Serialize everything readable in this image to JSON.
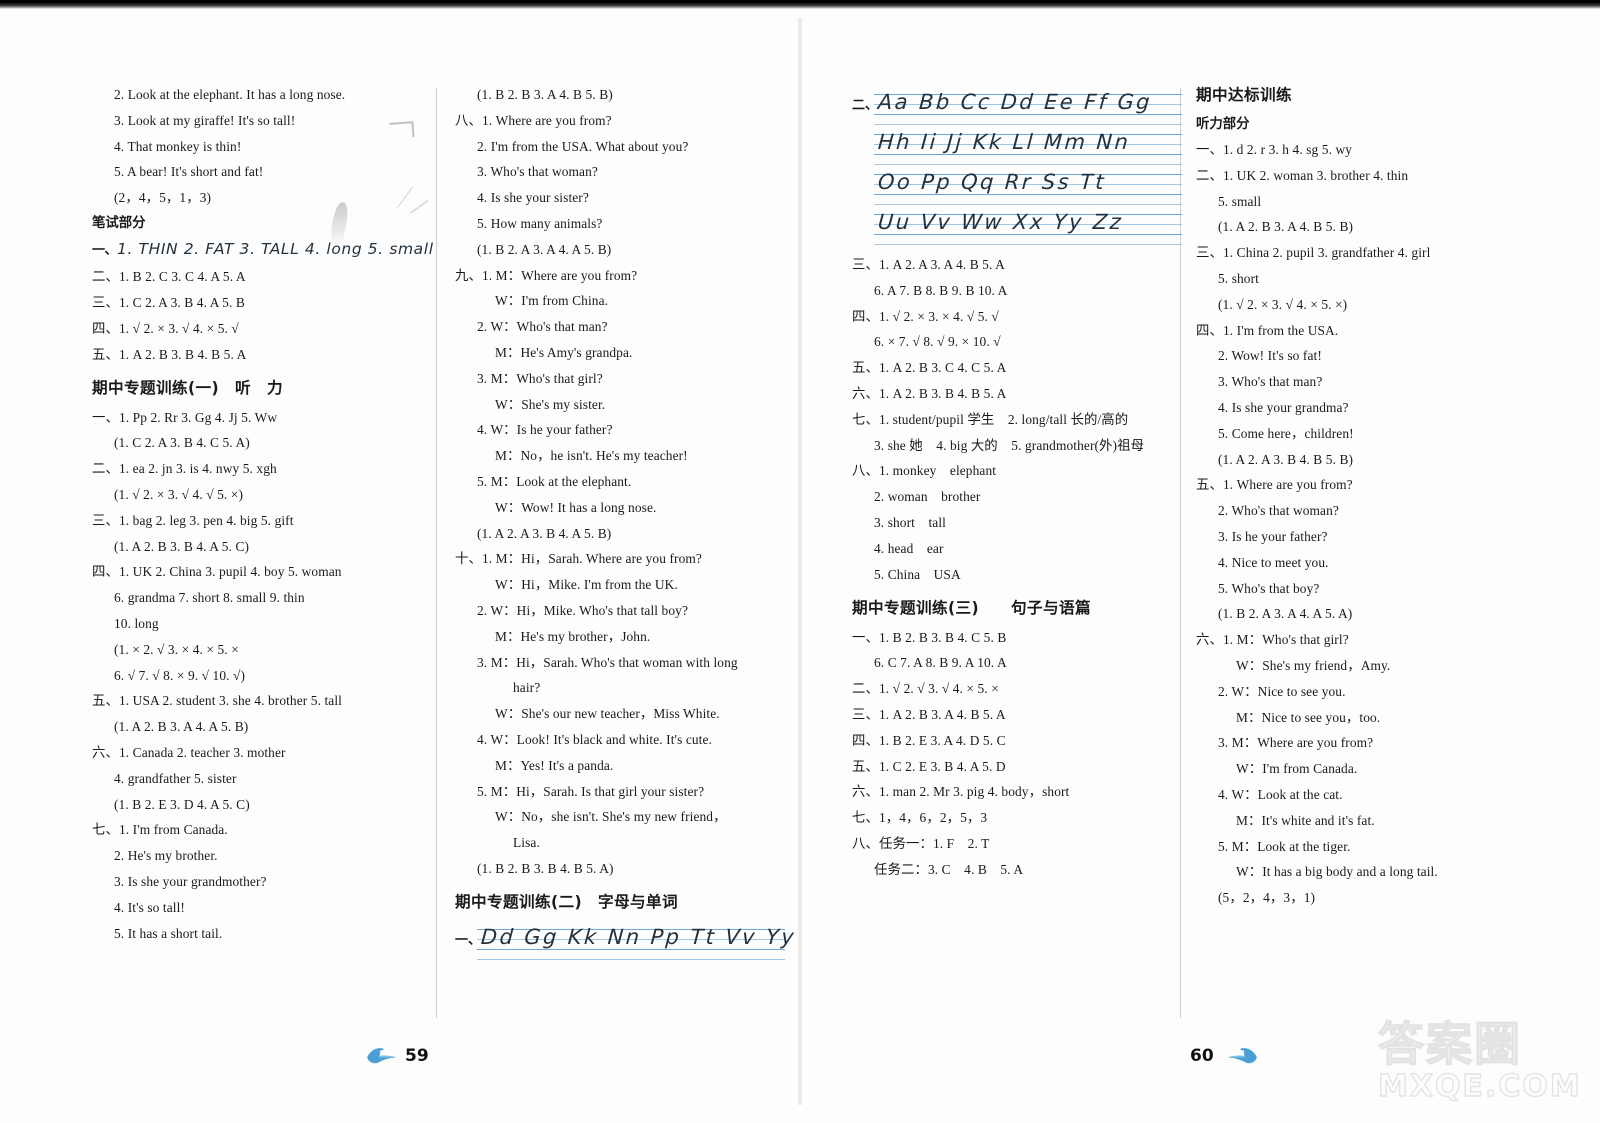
{
  "document": {
    "type": "workbook-answer-key",
    "left_page_number": "59",
    "right_page_number": "60"
  },
  "watermark": {
    "chinese": "答案圈",
    "url": "MXQE.COM"
  },
  "columns": {
    "col1": {
      "lines": [
        {
          "indent": 1,
          "text": "2. Look at the elephant. It has a long nose."
        },
        {
          "indent": 1,
          "text": "3. Look at my giraffe! It's so tall!"
        },
        {
          "indent": 1,
          "text": "4. That monkey is thin!"
        },
        {
          "indent": 1,
          "text": "5. A bear! It's short and fat!"
        },
        {
          "indent": 1,
          "text": "(2，4，5，1，3)"
        }
      ],
      "bishi_heading": "笔试部分",
      "written_lines": [
        {
          "indent": 0,
          "lead": "一、",
          "handwritten": "1. THIN  2. FAT  3. TALL  4. long  5. small"
        },
        {
          "indent": 0,
          "text": "二、1. B  2. C  3. C  4. A  5. A"
        },
        {
          "indent": 0,
          "text": "三、1. C  2. A  3. B  4. A  5. B"
        },
        {
          "indent": 0,
          "text": "四、1. √  2. ×  3. √  4. ×  5. √"
        },
        {
          "indent": 0,
          "text": "五、1. A  2. B  3. B  4. B  5. A"
        }
      ],
      "section_title": "期中专题训练(一)　听　力",
      "section_lines": [
        {
          "indent": 0,
          "text": "一、1. Pp  2. Rr  3. Gg  4. Jj  5. Ww"
        },
        {
          "indent": 1,
          "text": "(1. C  2. A  3. B  4. C  5. A)"
        },
        {
          "indent": 0,
          "text": "二、1. ea  2. jn  3. is  4. nwy  5. xgh"
        },
        {
          "indent": 1,
          "text": "(1. √  2. ×  3. √  4. √  5. ×)"
        },
        {
          "indent": 0,
          "text": "三、1. bag  2. leg  3. pen  4. big  5. gift"
        },
        {
          "indent": 1,
          "text": "(1. A  2. B  3. B  4. A  5. C)"
        },
        {
          "indent": 0,
          "text": "四、1. UK  2. China  3. pupil  4. boy  5. woman"
        },
        {
          "indent": 1,
          "text": "6. grandma  7. short  8. small  9. thin"
        },
        {
          "indent": 1,
          "text": "10. long"
        },
        {
          "indent": 1,
          "text": "(1. ×  2. √  3. ×  4. ×  5. ×"
        },
        {
          "indent": 1,
          "text": "6. √  7. √  8. ×  9. √  10. √)"
        },
        {
          "indent": 0,
          "text": "五、1. USA  2. student  3. she  4. brother  5. tall"
        },
        {
          "indent": 1,
          "text": "(1. A  2. B  3. A  4. A  5. B)"
        },
        {
          "indent": 0,
          "text": "六、1. Canada  2. teacher  3. mother"
        },
        {
          "indent": 1,
          "text": "4. grandfather  5. sister"
        },
        {
          "indent": 1,
          "text": "(1. B  2. E  3. D  4. A  5. C)"
        },
        {
          "indent": 0,
          "text": "七、1. I'm from Canada."
        },
        {
          "indent": 1,
          "text": "2. He's my brother."
        },
        {
          "indent": 1,
          "text": "3. Is she your grandmother?"
        },
        {
          "indent": 1,
          "text": "4. It's so tall!"
        },
        {
          "indent": 1,
          "text": "5. It has a short tail."
        }
      ]
    },
    "col2": {
      "lines": [
        {
          "indent": 1,
          "text": "(1. B  2. B  3. A  4. B  5. B)"
        },
        {
          "indent": 0,
          "text": "八、1. Where are you from?"
        },
        {
          "indent": 1,
          "text": "2. I'm from the USA. What about you?"
        },
        {
          "indent": 1,
          "text": "3. Who's that woman?"
        },
        {
          "indent": 1,
          "text": "4. Is she your sister?"
        },
        {
          "indent": 1,
          "text": "5. How many animals?"
        },
        {
          "indent": 1,
          "text": "(1. B  2. A  3. A  4. A  5. B)"
        },
        {
          "indent": 0,
          "text": "九、1. M：Where are you from?"
        },
        {
          "indent": 2,
          "text": "W：I'm from China."
        },
        {
          "indent": 1,
          "text": "2. W：Who's that man?"
        },
        {
          "indent": 2,
          "text": "M：He's Amy's grandpa."
        },
        {
          "indent": 1,
          "text": "3. M：Who's that girl?"
        },
        {
          "indent": 2,
          "text": "W：She's my sister."
        },
        {
          "indent": 1,
          "text": "4. W：Is he your father?"
        },
        {
          "indent": 2,
          "text": "M：No，he isn't. He's my teacher!"
        },
        {
          "indent": 1,
          "text": "5. M：Look at the elephant."
        },
        {
          "indent": 2,
          "text": "W：Wow! It has a long nose."
        },
        {
          "indent": 1,
          "text": "(1. A  2. A  3. B  4. A  5. B)"
        },
        {
          "indent": 0,
          "text": "十、1. M：Hi，Sarah. Where are you from?"
        },
        {
          "indent": 2,
          "text": "W：Hi，Mike. I'm from the UK."
        },
        {
          "indent": 1,
          "text": "2. W：Hi，Mike. Who's that tall boy?"
        },
        {
          "indent": 2,
          "text": "M：He's my brother，John."
        },
        {
          "indent": 1,
          "text": "3. M：Hi，Sarah. Who's that woman with long"
        },
        {
          "indent": 3,
          "text": "hair?"
        },
        {
          "indent": 2,
          "text": "W：She's our new teacher，Miss White."
        },
        {
          "indent": 1,
          "text": "4. W：Look! It's black and white. It's cute."
        },
        {
          "indent": 2,
          "text": "M：Yes! It's a panda."
        },
        {
          "indent": 1,
          "text": "5. M：Hi，Sarah. Is that girl your sister?"
        },
        {
          "indent": 2,
          "text": "W：No，she isn't. She's my new friend，"
        },
        {
          "indent": 3,
          "text": "Lisa."
        },
        {
          "indent": 1,
          "text": "(1. B  2. B  3. B  4. B  5. A)"
        }
      ],
      "section_title": "期中专题训练(二)　字母与单词",
      "handwriting_rows": [
        {
          "lead": "一、",
          "text": "Dd Gg Kk Nn Pp Tt Vv Yy"
        }
      ]
    },
    "col3": {
      "handwriting_rows": [
        {
          "lead": "二、",
          "text": "Aa Bb Cc Dd Ee Ff Gg"
        },
        {
          "lead": "",
          "text": "Hh Ii Jj Kk Ll Mm Nn"
        },
        {
          "lead": "",
          "text": "Oo Pp Qq Rr Ss Tt"
        },
        {
          "lead": "",
          "text": "Uu Vv Ww Xx Yy Zz"
        }
      ],
      "lines": [
        {
          "indent": 0,
          "text": "三、1. A  2. A  3. A  4. B  5. A"
        },
        {
          "indent": 1,
          "text": "6. A  7. B  8. B  9. B  10. A"
        },
        {
          "indent": 0,
          "text": "四、1. √  2. ×  3. ×  4. √  5. √"
        },
        {
          "indent": 1,
          "text": "6. ×  7. √  8. √  9. ×  10. √"
        },
        {
          "indent": 0,
          "text": "五、1. A  2. B  3. C  4. C  5. A"
        },
        {
          "indent": 0,
          "text": "六、1. A  2. B  3. B  4. B  5. A"
        },
        {
          "indent": 0,
          "text": "七、1. student/pupil 学生　2. long/tall 长的/高的"
        },
        {
          "indent": 1,
          "text": "3. she 她　4. big 大的　5. grandmother(外)祖母"
        },
        {
          "indent": 0,
          "text": "八、1. monkey　elephant"
        },
        {
          "indent": 1,
          "text": "2. woman　brother"
        },
        {
          "indent": 1,
          "text": "3. short　tall"
        },
        {
          "indent": 1,
          "text": "4. head　ear"
        },
        {
          "indent": 1,
          "text": "5. China　USA"
        }
      ],
      "section_title": "期中专题训练(三)　　句子与语篇",
      "section_lines": [
        {
          "indent": 0,
          "text": "一、1. B  2. B  3. B  4. C  5. B"
        },
        {
          "indent": 1,
          "text": "6. C  7. A  8. B  9. A  10. A"
        },
        {
          "indent": 0,
          "text": "二、1. √  2. √  3. √  4. ×  5. ×"
        },
        {
          "indent": 0,
          "text": "三、1. A  2. B  3. A  4. B  5. A"
        },
        {
          "indent": 0,
          "text": "四、1. B  2. E  3. A  4. D  5. C"
        },
        {
          "indent": 0,
          "text": "五、1. C  2. E  3. B  4. A  5. D"
        },
        {
          "indent": 0,
          "text": "六、1. man  2. Mr  3. pig  4. body，short"
        },
        {
          "indent": 0,
          "text": "七、1，4，6，2，5，3"
        },
        {
          "indent": 0,
          "text": "八、任务一：1. F　2. T"
        },
        {
          "indent": 1,
          "text": "任务二：3. C　4. B　5. A"
        }
      ]
    },
    "col4": {
      "section_title": "期中达标训练",
      "sub_title": "听力部分",
      "lines": [
        {
          "indent": 0,
          "text": "一、1. d  2. r  3. h  4. sg  5. wy"
        },
        {
          "indent": 0,
          "text": "二、1. UK  2. woman  3. brother  4. thin"
        },
        {
          "indent": 1,
          "text": "5. small"
        },
        {
          "indent": 1,
          "text": "(1. A  2. B  3. A  4. B  5. B)"
        },
        {
          "indent": 0,
          "text": "三、1. China  2. pupil  3. grandfather  4. girl"
        },
        {
          "indent": 1,
          "text": "5. short"
        },
        {
          "indent": 1,
          "text": "(1. √  2. ×  3. √  4. ×  5. ×)"
        },
        {
          "indent": 0,
          "text": "四、1. I'm from the USA."
        },
        {
          "indent": 1,
          "text": "2. Wow! It's so fat!"
        },
        {
          "indent": 1,
          "text": "3. Who's that man?"
        },
        {
          "indent": 1,
          "text": "4. Is she your grandma?"
        },
        {
          "indent": 1,
          "text": "5. Come here，children!"
        },
        {
          "indent": 1,
          "text": "(1. A  2. A  3. B  4. B  5. B)"
        },
        {
          "indent": 0,
          "text": "五、1. Where are you from?"
        },
        {
          "indent": 1,
          "text": "2. Who's that woman?"
        },
        {
          "indent": 1,
          "text": "3. Is he your father?"
        },
        {
          "indent": 1,
          "text": "4. Nice to meet you."
        },
        {
          "indent": 1,
          "text": "5. Who's that boy?"
        },
        {
          "indent": 1,
          "text": "(1. B  2. A  3. A  4. A  5. A)"
        },
        {
          "indent": 0,
          "text": "六、1. M：Who's that girl?"
        },
        {
          "indent": 2,
          "text": "W：She's my friend，Amy."
        },
        {
          "indent": 1,
          "text": "2. W：Nice to see you."
        },
        {
          "indent": 2,
          "text": "M：Nice to see you，too."
        },
        {
          "indent": 1,
          "text": "3. M：Where are you from?"
        },
        {
          "indent": 2,
          "text": "W：I'm from Canada."
        },
        {
          "indent": 1,
          "text": "4. W：Look at the cat."
        },
        {
          "indent": 2,
          "text": "M：It's white and it's fat."
        },
        {
          "indent": 1,
          "text": "5. M：Look at the tiger."
        },
        {
          "indent": 2,
          "text": "W：It has a big body and a long tail."
        },
        {
          "indent": 1,
          "text": "(5，2，4，3，1)"
        }
      ]
    }
  }
}
